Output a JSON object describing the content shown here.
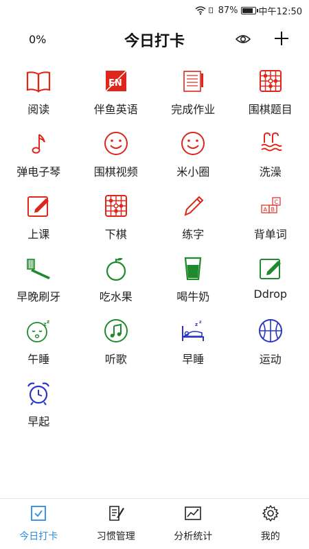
{
  "status_bar": {
    "battery": "87%",
    "time": "中午12:50"
  },
  "header": {
    "progress": "0%",
    "title": "今日打卡"
  },
  "colors": {
    "red": "#e0251b",
    "green": "#1e8a2c",
    "blue": "#2835c6",
    "tab_active": "#2a8be4"
  },
  "habits": [
    {
      "label": "阅读",
      "icon": "book-icon"
    },
    {
      "label": "伴鱼英语",
      "icon": "english-app-icon"
    },
    {
      "label": "完成作业",
      "icon": "notebook-icon"
    },
    {
      "label": "围棋题目",
      "icon": "go-board-icon"
    },
    {
      "label": "弹电子琴",
      "icon": "music-note-icon"
    },
    {
      "label": "围棋视频",
      "icon": "smiley-icon"
    },
    {
      "label": "米小圈",
      "icon": "smiley-icon"
    },
    {
      "label": "洗澡",
      "icon": "bath-icon"
    },
    {
      "label": "上课",
      "icon": "edit-square-icon"
    },
    {
      "label": "下棋",
      "icon": "go-board-icon"
    },
    {
      "label": "练字",
      "icon": "pencil-icon"
    },
    {
      "label": "背单词",
      "icon": "abc-blocks-icon"
    },
    {
      "label": "早晚刷牙",
      "icon": "toothbrush-icon"
    },
    {
      "label": "吃水果",
      "icon": "fruit-icon"
    },
    {
      "label": "喝牛奶",
      "icon": "cup-icon"
    },
    {
      "label": "Ddrop",
      "icon": "edit-square-icon"
    },
    {
      "label": "午睡",
      "icon": "sleepy-face-icon"
    },
    {
      "label": "听歌",
      "icon": "music-circle-icon"
    },
    {
      "label": "早睡",
      "icon": "bed-icon"
    },
    {
      "label": "运动",
      "icon": "basketball-icon"
    },
    {
      "label": "早起",
      "icon": "alarm-clock-icon"
    }
  ],
  "tabs": [
    {
      "label": "今日打卡",
      "icon": "checkbox-icon",
      "active": true
    },
    {
      "label": "习惯管理",
      "icon": "list-edit-icon",
      "active": false
    },
    {
      "label": "分析统计",
      "icon": "chart-icon",
      "active": false
    },
    {
      "label": "我的",
      "icon": "gear-icon",
      "active": false
    }
  ]
}
